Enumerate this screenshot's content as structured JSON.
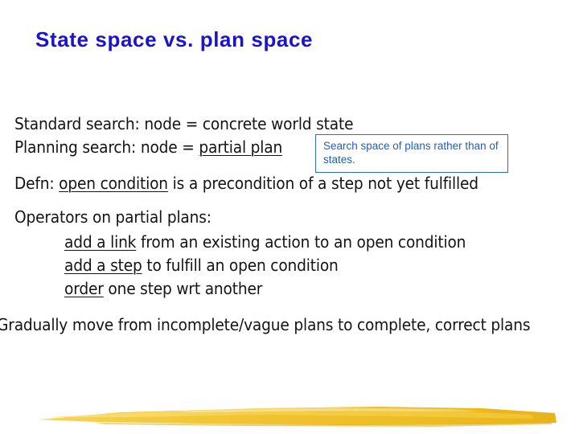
{
  "slide": {
    "title": "State space vs. plan space",
    "background_color": "#ffffff",
    "title_color": "#1a14cc",
    "body_color": "#141414"
  },
  "body": {
    "standard_search": {
      "prefix": "Standard search:  node = concrete world state"
    },
    "planning_search": {
      "prefix": "Planning search:  node = ",
      "underlined": "partial plan"
    },
    "defn": {
      "prefix": "Defn: ",
      "underlined": "open condition",
      "suffix": " is a precondition of a step not yet fulfilled"
    },
    "operators_heading": "Operators on partial plans:",
    "operators": [
      {
        "underlined": "add a link",
        "rest": " from an existing action to an open condition"
      },
      {
        "underlined": "add a step",
        "rest": " to fulfill an open condition"
      },
      {
        "underlined": "order",
        "rest": " one step wrt another"
      }
    ],
    "conclusion": "Gradually move from incomplete/vague plans to complete, correct plans"
  },
  "callout": {
    "text": "Search space of plans rather than of states.",
    "border_color": "#2e6fb5",
    "text_color": "#1f5fc4",
    "background_color": "#ffffff"
  },
  "decoration": {
    "brush_stroke_color": "#f0c22e",
    "brush_stroke_highlight": "#f7d65c",
    "brush_stroke_shadow": "#e0ab18"
  }
}
